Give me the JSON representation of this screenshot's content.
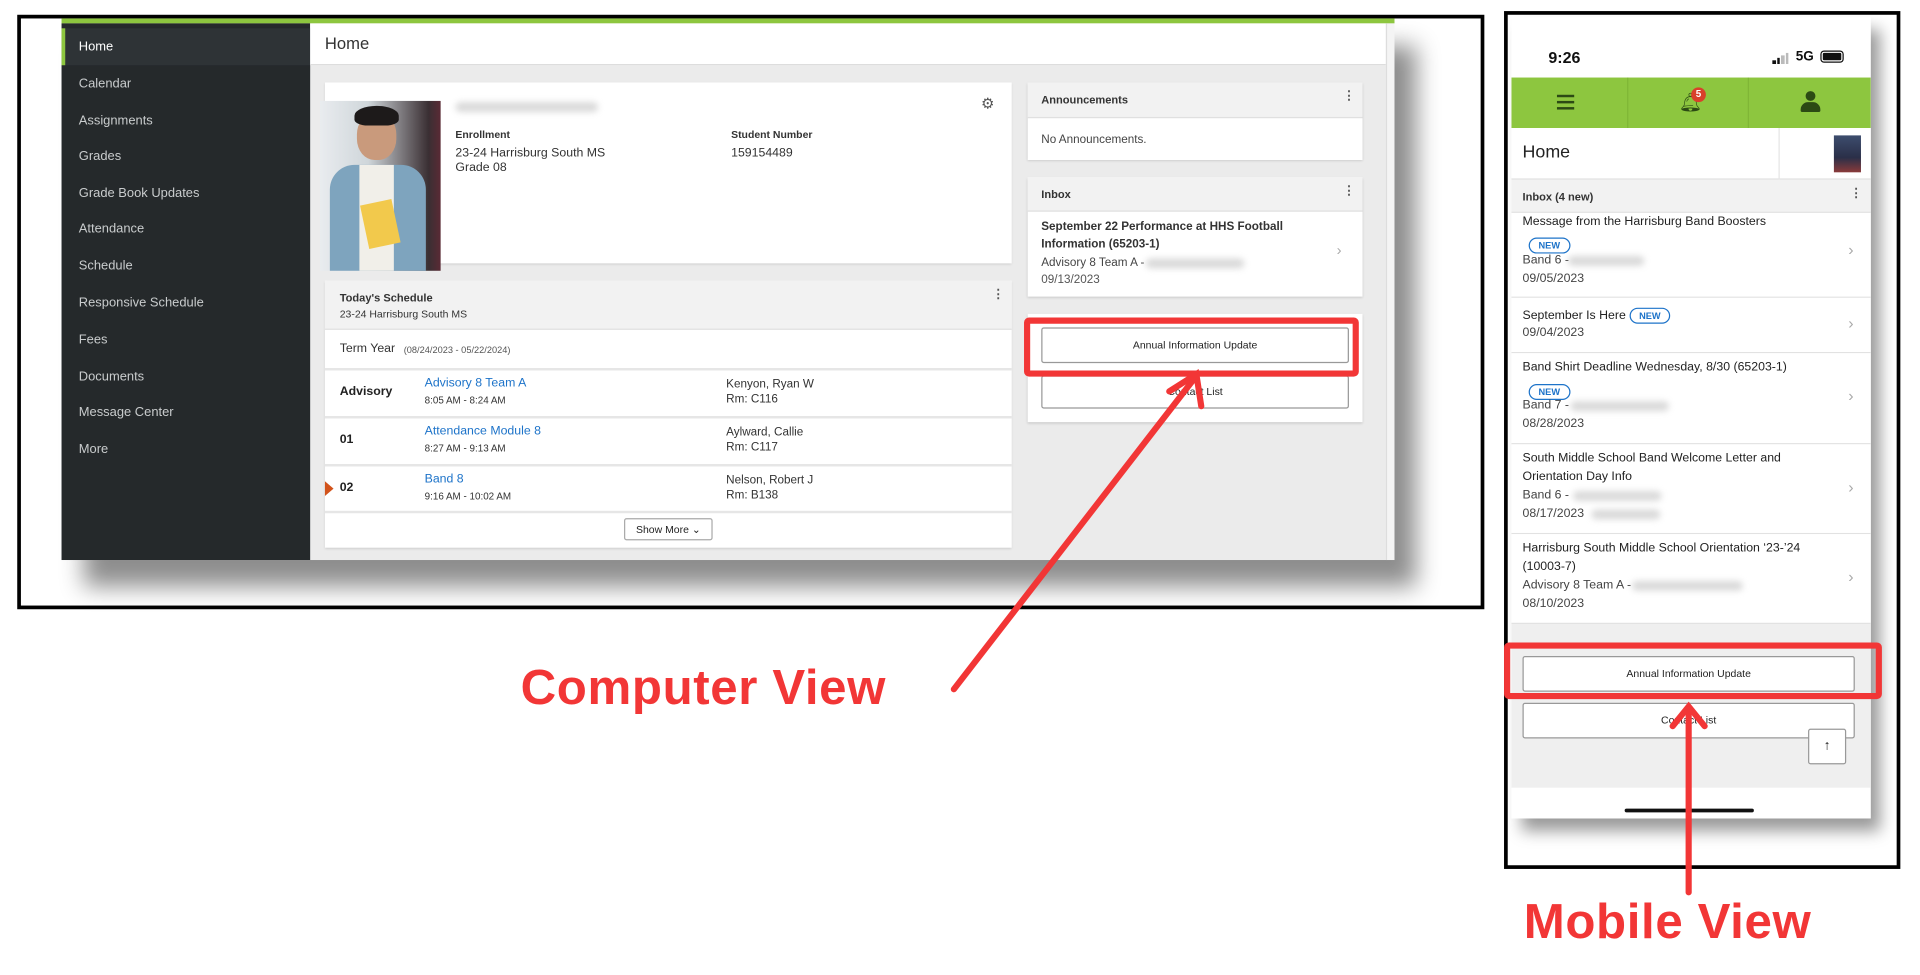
{
  "desktop": {
    "sidebar": {
      "items": [
        {
          "label": "Home",
          "active": true
        },
        {
          "label": "Calendar"
        },
        {
          "label": "Assignments"
        },
        {
          "label": "Grades"
        },
        {
          "label": "Grade Book Updates"
        },
        {
          "label": "Attendance"
        },
        {
          "label": "Schedule"
        },
        {
          "label": "Responsive Schedule"
        },
        {
          "label": "Fees"
        },
        {
          "label": "Documents"
        },
        {
          "label": "Message Center"
        },
        {
          "label": "More"
        }
      ]
    },
    "header": {
      "title": "Home"
    },
    "profile": {
      "enrollment_label": "Enrollment",
      "enrollment_school": "23-24 Harrisburg South MS",
      "enrollment_grade": "Grade 08",
      "student_number_label": "Student Number",
      "student_number": "159154489",
      "settings_icon": "gear-icon"
    },
    "schedule": {
      "title": "Today's Schedule",
      "school": "23-24 Harrisburg South MS",
      "term_label": "Term Year",
      "term_dates": "(08/24/2023 - 05/22/2024)",
      "rows": [
        {
          "period": "Advisory",
          "course": "Advisory 8 Team A",
          "time": "8:05 AM - 8:24 AM",
          "teacher": "Kenyon, Ryan W",
          "room": "Rm: C116"
        },
        {
          "period": "01",
          "course": "Attendance Module 8",
          "time": "8:27 AM - 9:13 AM",
          "teacher": "Aylward, Callie",
          "room": "Rm: C117"
        },
        {
          "period": "02",
          "course": "Band 8",
          "time": "9:16 AM - 10:02 AM",
          "teacher": "Nelson, Robert J",
          "room": "Rm: B138",
          "current": true
        }
      ],
      "show_more": "Show More"
    },
    "announcements": {
      "title": "Announcements",
      "body": "No Announcements."
    },
    "inbox": {
      "title": "Inbox",
      "message_line1": "September 22 Performance at HHS Football",
      "message_line2": "Information (65203-1)",
      "sender": "Advisory 8 Team A -",
      "date": "09/13/2023"
    },
    "buttons": {
      "annual_update": "Annual Information Update",
      "contact_list": "Contact List"
    }
  },
  "mobile": {
    "status": {
      "time": "9:26",
      "network": "5G"
    },
    "nav": {
      "menu_icon": "hamburger-icon",
      "bell_icon": "bell-icon",
      "badge": "5",
      "user_icon": "person-icon"
    },
    "title": "Home",
    "inbox_header": "Inbox (4 new)",
    "new_label": "NEW",
    "messages": [
      {
        "title": "Message from the Harrisburg Band Boosters",
        "sender": "Band 6 -",
        "date": "09/05/2023",
        "new": true
      },
      {
        "title": "September Is Here",
        "date": "09/04/2023",
        "new": true
      },
      {
        "title": "Band Shirt Deadline Wednesday, 8/30 (65203-1)",
        "sender": "Band 7 -",
        "date": "08/28/2023",
        "new": true
      },
      {
        "title": "South Middle School Band Welcome Letter and",
        "title2": "Orientation Day Info",
        "sender": "Band 6 -",
        "date": "08/17/2023"
      },
      {
        "title": "Harrisburg South Middle School Orientation ‘23-’24",
        "title2": "(10003-7)",
        "sender": "Advisory 8 Team A -",
        "date": "08/10/2023"
      }
    ],
    "buttons": {
      "annual_update": "Annual Information Update",
      "contact_list": "Contact List"
    }
  },
  "callouts": {
    "computer": "Computer View",
    "mobile": "Mobile View",
    "color": "#f23636"
  },
  "colors": {
    "brand_green": "#8dc63f",
    "sidebar": "#25292b",
    "link": "#1d73c9"
  }
}
